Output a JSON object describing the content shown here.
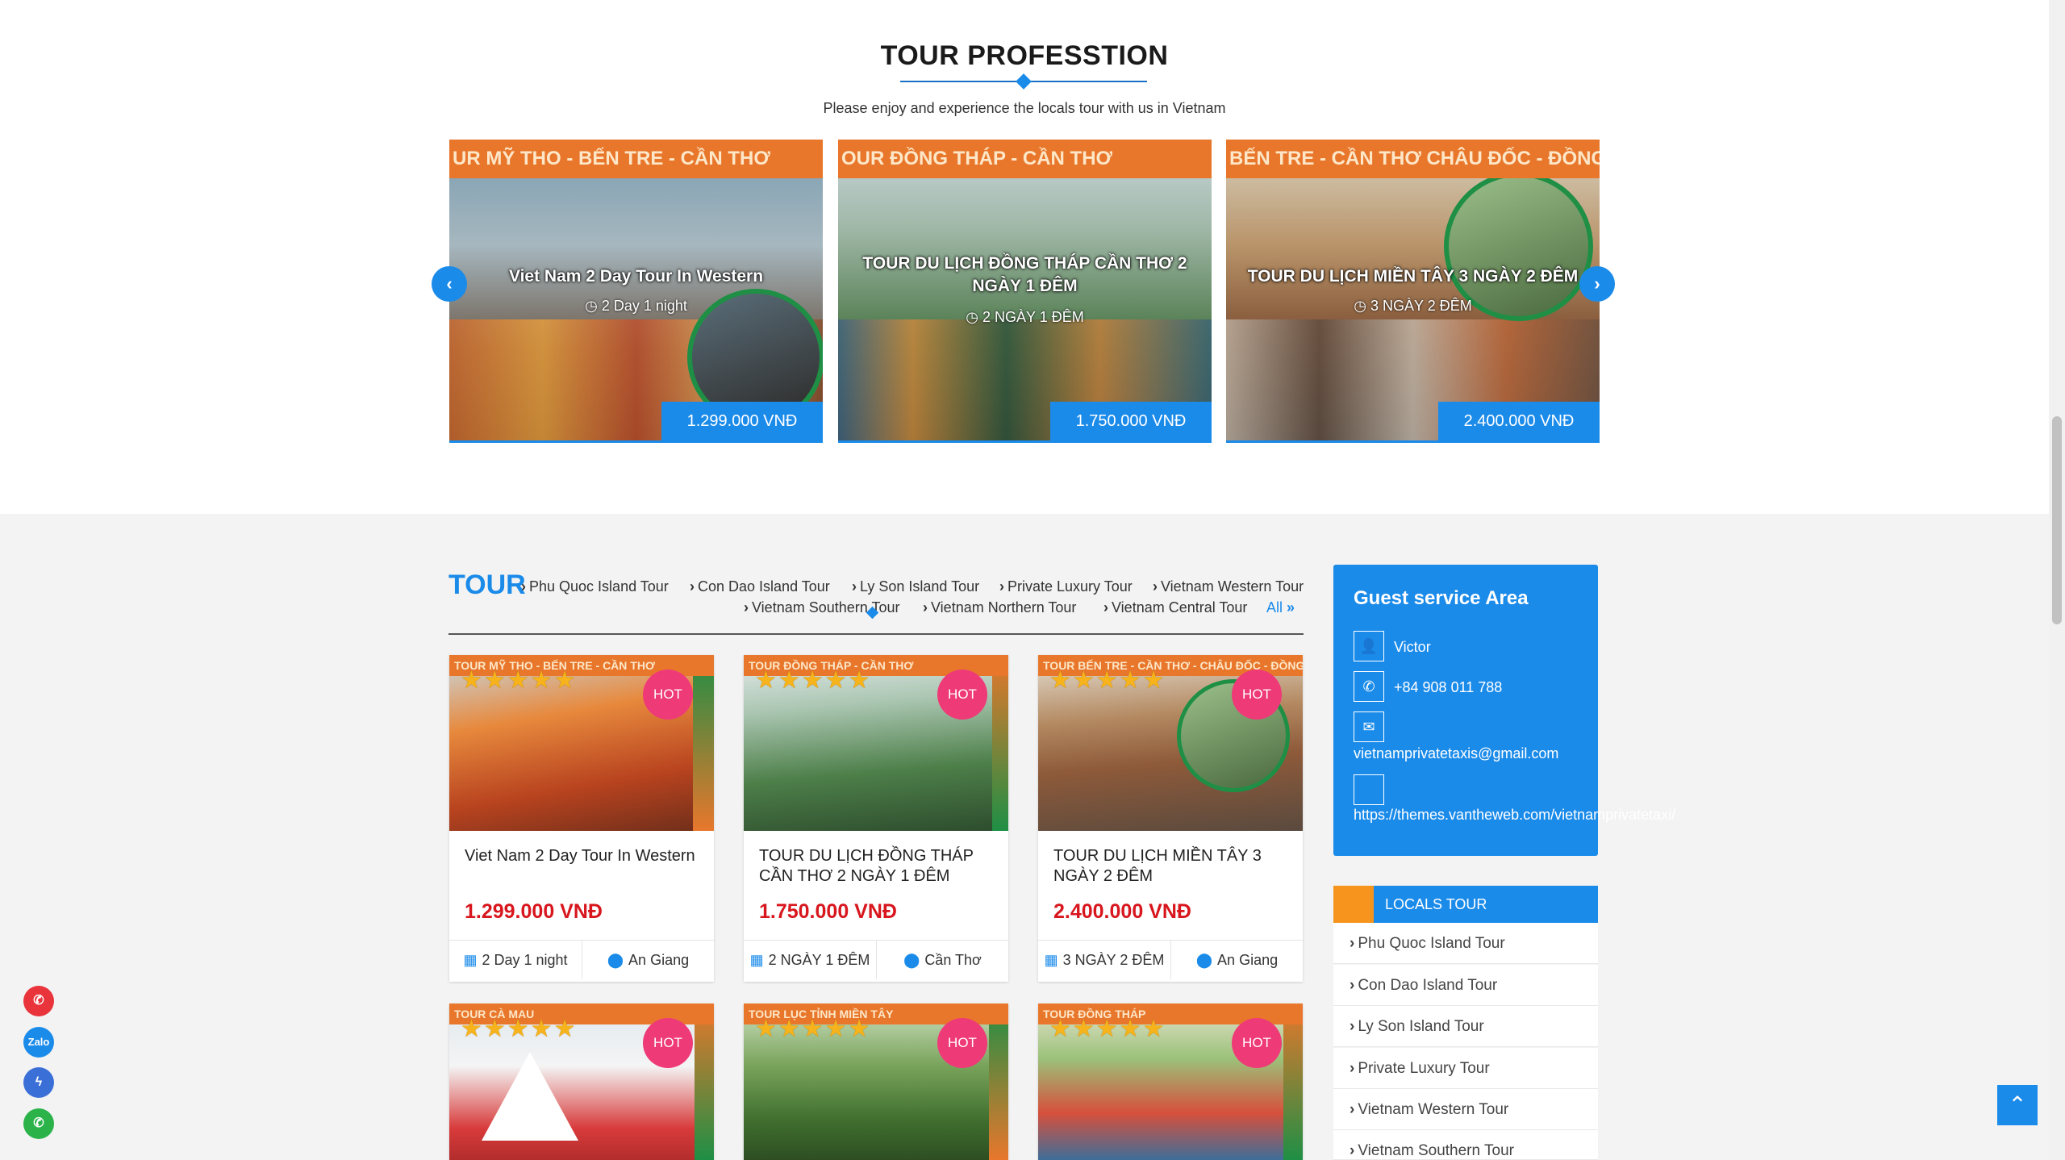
{
  "section": {
    "title": "TOUR PROFESSTION",
    "subtitle": "Please enjoy and experience the locals tour with us in Vietnam"
  },
  "slides": [
    {
      "banner": "UR MỸ THO - BẾN TRE - CẦN THƠ",
      "title": "Viet Nam 2 Day Tour In Western",
      "duration": "2 Day 1 night",
      "price": "1.299.000 VNĐ"
    },
    {
      "banner": "OUR ĐỒNG THÁP - CẦN THƠ",
      "title": "TOUR DU LỊCH ĐỒNG THÁP CẦN THƠ 2 NGÀY 1 ĐÊM",
      "duration": "2 NGÀY 1 ĐÊM",
      "price": "1.750.000 VNĐ"
    },
    {
      "banner": "BẾN TRE - CẦN THƠ CHÂU ĐỐC - ĐỒNG THÁP",
      "title": "TOUR DU LỊCH MIỀN TÂY 3 NGÀY 2 ĐÊM",
      "duration": "3 NGÀY 2 ĐÊM",
      "price": "2.400.000 VNĐ"
    }
  ],
  "tour": {
    "heading": "TOUR",
    "categories": [
      "Phu Quoc Island Tour",
      "Con Dao Island Tour",
      "Ly Son Island Tour",
      "Private Luxury Tour",
      "Vietnam Western Tour",
      "Vietnam Southern Tour",
      "Vietnam Northern Tour",
      "Vietnam Central Tour"
    ],
    "all_label": "All"
  },
  "cards": [
    {
      "banner": "TOUR MỸ THO - BẾN TRE - CẦN THƠ",
      "badge": "HOT",
      "title": "Viet Nam 2 Day Tour In Western",
      "price": "1.299.000 VNĐ",
      "duration": "2 Day 1 night",
      "location": "An Giang",
      "stars": 5
    },
    {
      "banner": "TOUR ĐỒNG THÁP - CẦN THƠ",
      "badge": "HOT",
      "title": "TOUR DU LỊCH ĐỒNG THÁP CẦN THƠ 2 NGÀY 1 ĐÊM",
      "price": "1.750.000 VNĐ",
      "duration": "2 NGÀY 1 ĐÊM",
      "location": "Cần Thơ",
      "stars": 5
    },
    {
      "banner": "TOUR BẾN TRE - CẦN THƠ - CHÂU ĐỐC - ĐỒNG THÁP",
      "badge": "HOT",
      "title": "TOUR DU LỊCH MIỀN TÂY 3 NGÀY 2 ĐÊM",
      "price": "2.400.000 VNĐ",
      "duration": "3 NGÀY 2 ĐÊM",
      "location": "An Giang",
      "stars": 5
    },
    {
      "banner": "TOUR CÀ MAU",
      "badge": "HOT",
      "stars": 5
    },
    {
      "banner": "TOUR LỤC TỈNH MIỀN TÂY",
      "badge": "HOT",
      "stars": 5
    },
    {
      "banner": "TOUR ĐỒNG THÁP",
      "badge": "HOT",
      "stars": 5
    }
  ],
  "guest": {
    "title": "Guest service Area",
    "name": "Victor",
    "phone": "+84 908 011 788",
    "email": "vietnamprivatetaxis@gmail.com",
    "website": "https://themes.vantheweb.com/vietnamprivatetaxi/"
  },
  "locals_tour": {
    "label": "LOCALS TOUR",
    "items": [
      "Phu Quoc Island Tour",
      "Con Dao Island Tour",
      "Ly Son Island Tour",
      "Private Luxury Tour",
      "Vietnam Western Tour",
      "Vietnam Southern Tour"
    ]
  },
  "colors": {
    "accent": "#1b8bea",
    "price_red": "#d8161d",
    "hot_pink": "#ef3a78",
    "orange": "#f7941d"
  },
  "icons": {
    "prev": "chevron-left-icon",
    "next": "chevron-right-icon",
    "clock": "clock-icon",
    "calendar": "calendar-icon",
    "pin": "map-pin-icon",
    "user": "user-icon",
    "phone": "phone-icon",
    "mail": "mail-icon",
    "to_top": "chevron-up-icon"
  }
}
